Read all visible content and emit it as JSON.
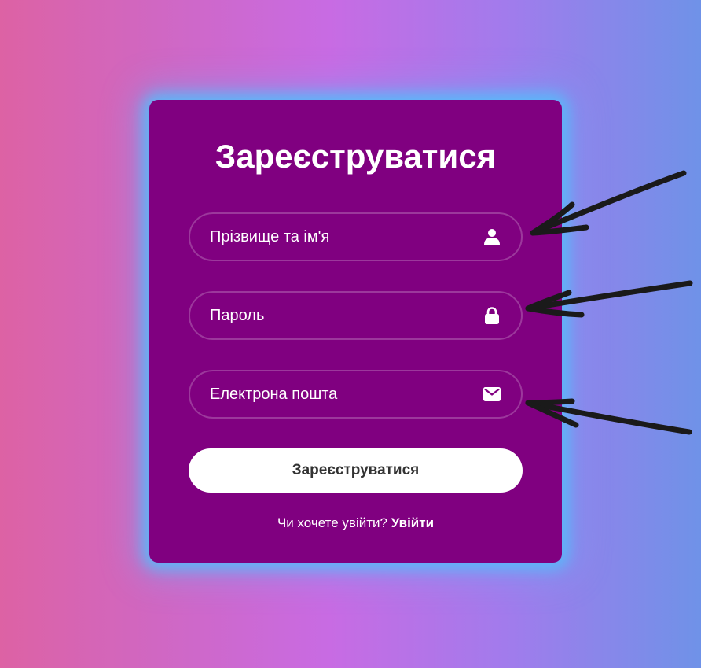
{
  "form": {
    "title": "Зареєструватися",
    "fields": [
      {
        "placeholder": "Прізвище та ім'я",
        "icon": "user-icon"
      },
      {
        "placeholder": "Пароль",
        "icon": "lock-icon"
      },
      {
        "placeholder": "Електрона пошта",
        "icon": "envelope-icon"
      }
    ],
    "submit_label": "Зареєструватися",
    "login_prompt": "Чи хочете увійти?",
    "login_link": "Увійти"
  },
  "colors": {
    "card_background": "#800080",
    "card_glow": "#56bafa",
    "button_background": "#ffffff",
    "button_text": "#333333",
    "arrow": "#1a1a1a"
  },
  "annotations": {
    "arrow_count": 3
  }
}
